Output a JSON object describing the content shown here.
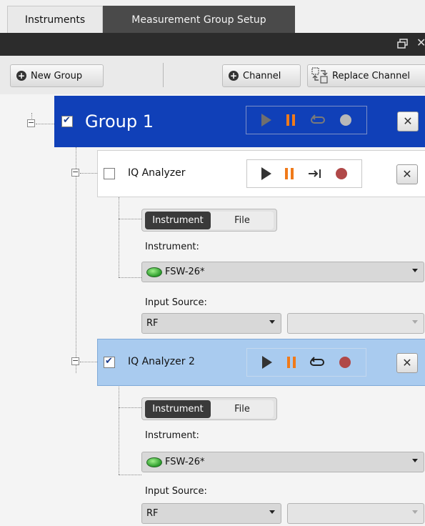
{
  "tabs": [
    {
      "label": "Instruments",
      "active": false
    },
    {
      "label": "Measurement Group Setup",
      "active": true
    }
  ],
  "toolbar": {
    "new_group": "New Group",
    "channel": "Channel",
    "replace_channel": "Replace Channel"
  },
  "group": {
    "title": "Group 1",
    "checked": true,
    "close": "✕"
  },
  "channels": [
    {
      "title": "IQ Analyzer",
      "checked": false,
      "source_toggle": {
        "instrument": "Instrument",
        "file": "File",
        "selected": "Instrument"
      },
      "instrument_label": "Instrument:",
      "instrument_value": "FSW-26*",
      "input_source_label": "Input Source:",
      "input_source_value": "RF",
      "secondary_value": "",
      "close": "✕"
    },
    {
      "title": "IQ Analyzer 2",
      "checked": true,
      "source_toggle": {
        "instrument": "Instrument",
        "file": "File",
        "selected": "Instrument"
      },
      "instrument_label": "Instrument:",
      "instrument_value": "FSW-26*",
      "input_source_label": "Input Source:",
      "input_source_value": "RF",
      "secondary_value": "",
      "close": "✕"
    }
  ],
  "colors": {
    "group_header": "#1040b8",
    "channel1_bg": "#ffffff",
    "channel2_bg": "#a9cbef",
    "pause": "#f07a1a",
    "record": "#b04848",
    "led": "#3cb83c"
  },
  "icons": [
    "plus-circle-icon",
    "replace-channel-icon",
    "play-icon",
    "pause-icon",
    "repeat-icon",
    "single-run-icon",
    "record-icon",
    "close-icon",
    "led-icon",
    "restore-window-icon"
  ]
}
